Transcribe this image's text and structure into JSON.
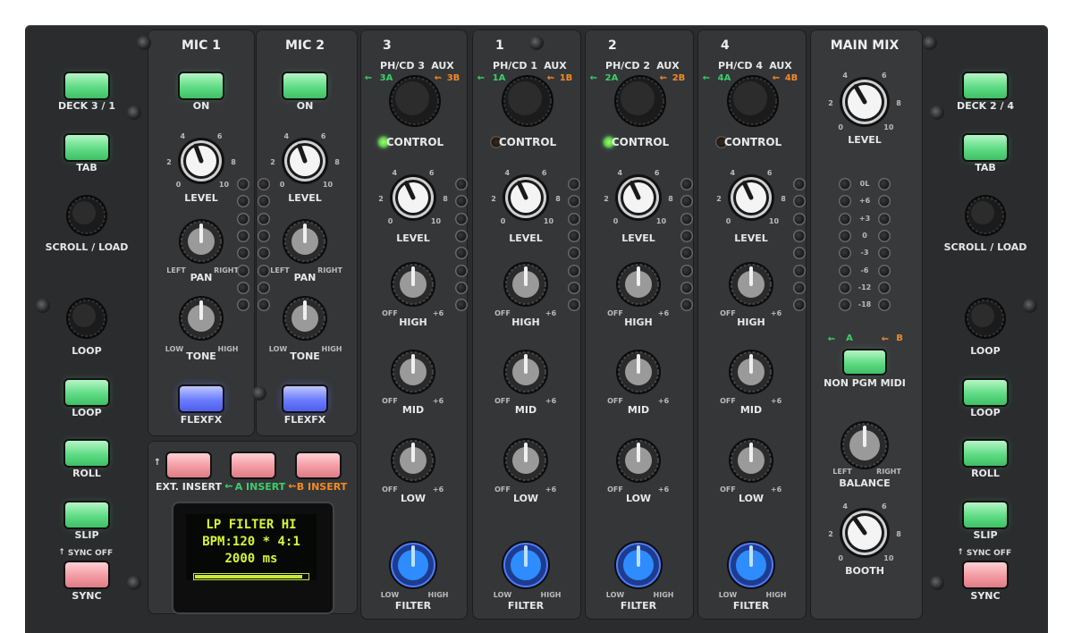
{
  "decks_left": {
    "deck_label": "DECK 3 / 1",
    "tab": "TAB",
    "scroll": "SCROLL / LOAD",
    "loop_knob": "LOOP",
    "loop_btn": "LOOP",
    "roll": "ROLL",
    "slip": "SLIP",
    "sync_off": "SYNC OFF",
    "sync": "SYNC"
  },
  "decks_right": {
    "deck_label": "DECK 2 / 4",
    "tab": "TAB",
    "scroll": "SCROLL / LOAD",
    "loop_knob": "LOOP",
    "loop_btn": "LOOP",
    "roll": "ROLL",
    "slip": "SLIP",
    "sync_off": "SYNC OFF",
    "sync": "SYNC"
  },
  "mics": [
    {
      "title": "MIC 1",
      "on": "ON",
      "level": "LEVEL",
      "pan": "PAN",
      "tone": "TONE",
      "left": "LEFT",
      "right": "RIGHT",
      "low": "LOW",
      "high": "HIGH",
      "flexfx": "FLEXFX"
    },
    {
      "title": "MIC 2",
      "on": "ON",
      "level": "LEVEL",
      "pan": "PAN",
      "tone": "TONE",
      "left": "LEFT",
      "right": "RIGHT",
      "low": "LOW",
      "high": "HIGH",
      "flexfx": "FLEXFX"
    }
  ],
  "level_ticks": {
    "t0": "0",
    "t2": "2",
    "t4": "4",
    "t6": "6",
    "t8": "8",
    "t10": "10"
  },
  "channels": [
    {
      "num": "3",
      "src": "PH/CD 3",
      "aux": "AUX",
      "usb_a": "3A",
      "usb_b": "3B",
      "control": "CONTROL",
      "control_on": true,
      "level": "LEVEL",
      "high": "HIGH",
      "mid": "MID",
      "low": "LOW",
      "filter": "FILTER",
      "off": "OFF",
      "plus6": "+6",
      "flow": "LOW",
      "fhigh": "HIGH"
    },
    {
      "num": "1",
      "src": "PH/CD 1",
      "aux": "AUX",
      "usb_a": "1A",
      "usb_b": "1B",
      "control": "CONTROL",
      "control_on": false,
      "level": "LEVEL",
      "high": "HIGH",
      "mid": "MID",
      "low": "LOW",
      "filter": "FILTER",
      "off": "OFF",
      "plus6": "+6",
      "flow": "LOW",
      "fhigh": "HIGH"
    },
    {
      "num": "2",
      "src": "PH/CD 2",
      "aux": "AUX",
      "usb_a": "2A",
      "usb_b": "2B",
      "control": "CONTROL",
      "control_on": true,
      "level": "LEVEL",
      "high": "HIGH",
      "mid": "MID",
      "low": "LOW",
      "filter": "FILTER",
      "off": "OFF",
      "plus6": "+6",
      "flow": "LOW",
      "fhigh": "HIGH"
    },
    {
      "num": "4",
      "src": "PH/CD 4",
      "aux": "AUX",
      "usb_a": "4A",
      "usb_b": "4B",
      "control": "CONTROL",
      "control_on": false,
      "level": "LEVEL",
      "high": "HIGH",
      "mid": "MID",
      "low": "LOW",
      "filter": "FILTER",
      "off": "OFF",
      "plus6": "+6",
      "flow": "LOW",
      "fhigh": "HIGH"
    }
  ],
  "main": {
    "title": "MAIN MIX",
    "level": "LEVEL",
    "meter": [
      "0L",
      "+6",
      "+3",
      "0",
      "-3",
      "-6",
      "-12",
      "-18"
    ],
    "route_a": "A",
    "route_b": "B",
    "nonpgm": "NON PGM MIDI",
    "balance": "BALANCE",
    "left": "LEFT",
    "right": "RIGHT",
    "booth": "BOOTH"
  },
  "insert": {
    "ext": "EXT. INSERT",
    "a": "A INSERT",
    "b": "B INSERT"
  },
  "oled": {
    "line1": "LP FILTER HI",
    "line2": "BPM:120 *  4:1",
    "line3": "2000 ms",
    "progress": 0.95
  },
  "colors": {
    "green": "#5fdc85",
    "red": "#f39aa2",
    "blue": "#6b7cff",
    "usb_a": "#3ccf6a",
    "usb_b": "#f28a2a",
    "oled": "#d8f53a"
  },
  "icons": {
    "usb": "usb-icon",
    "screw": "screw-icon",
    "arrow_up": "arrow-up-icon"
  }
}
